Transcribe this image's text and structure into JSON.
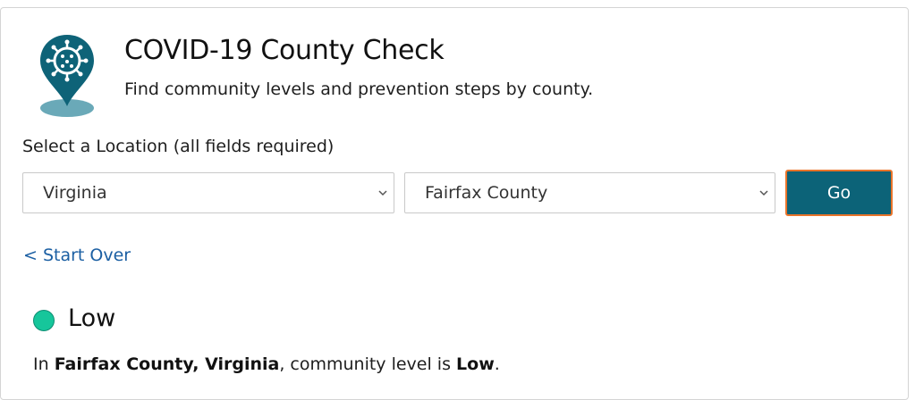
{
  "header": {
    "title": "COVID-19 County Check",
    "subtitle": "Find community levels and prevention steps by county.",
    "logo_icon": "virus-location-pin-icon"
  },
  "location": {
    "label": "Select a Location (all fields required)",
    "state_select": {
      "value": "Virginia"
    },
    "county_select": {
      "value": "Fairfax County"
    },
    "go_label": "Go",
    "start_over_label": "< Start Over"
  },
  "result": {
    "level": "Low",
    "level_color": "#16c69b",
    "summary_prefix": "In ",
    "summary_place": "Fairfax County, Virginia",
    "summary_middle": ", community level is ",
    "summary_level": "Low",
    "summary_suffix": "."
  },
  "colors": {
    "accent": "#0c6378",
    "focus_outline": "#e9742a",
    "link": "#1b5fa3"
  }
}
